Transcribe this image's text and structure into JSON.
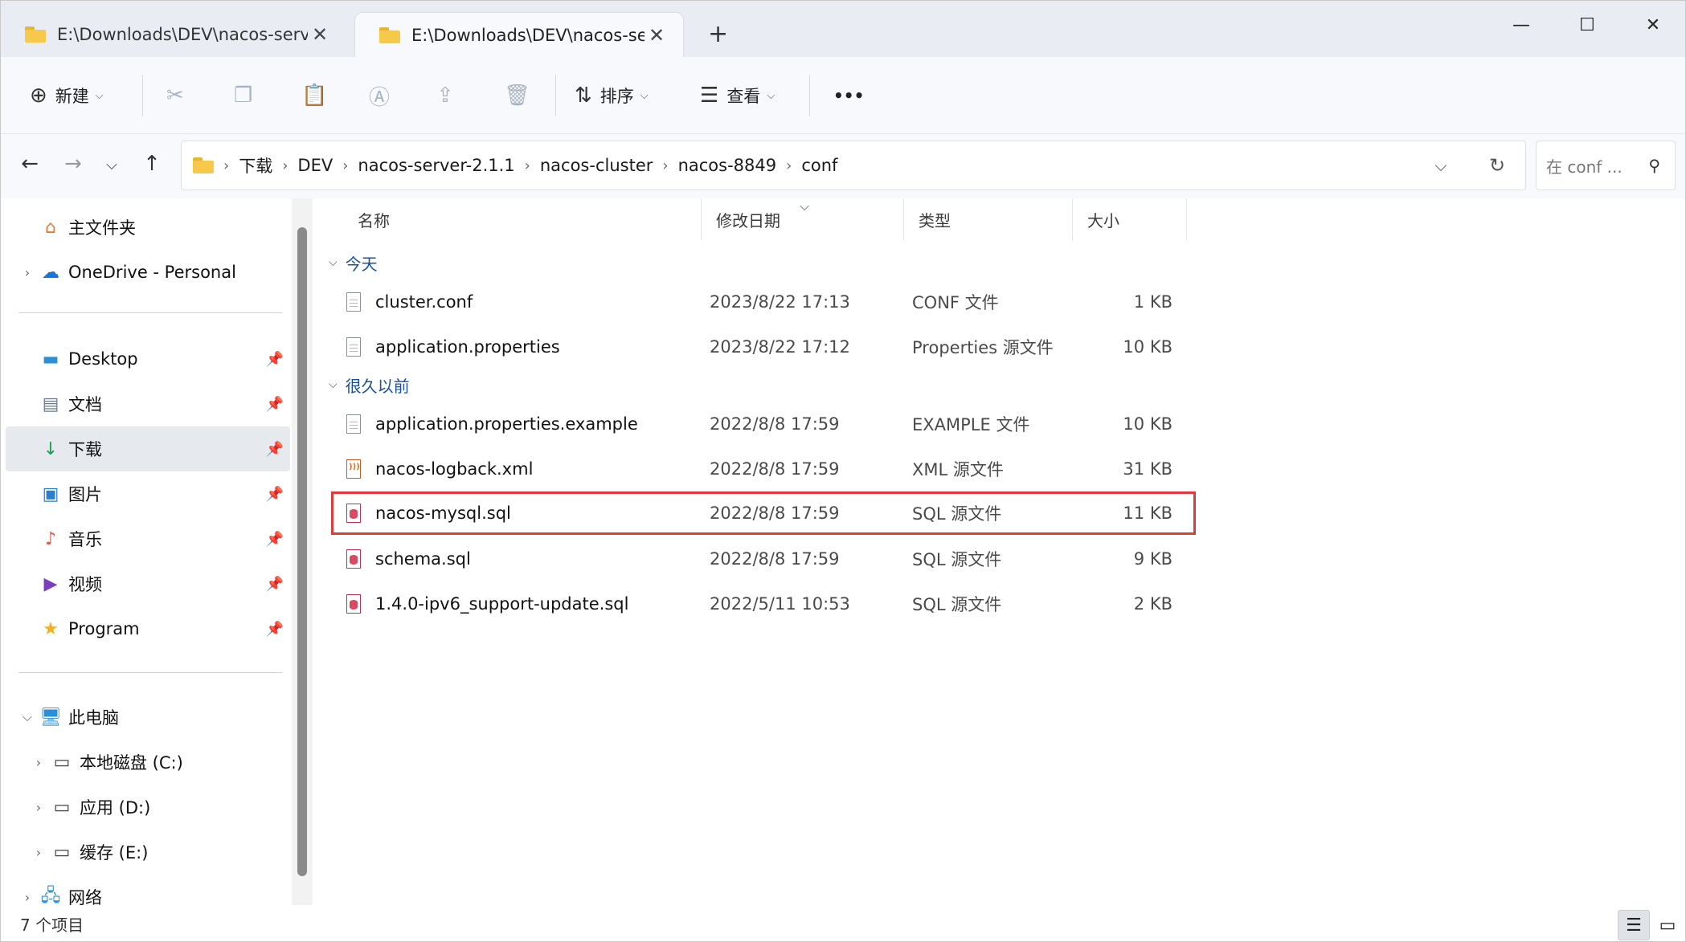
{
  "tabs": [
    {
      "title": "E:\\Downloads\\DEV\\nacos-serv",
      "active": false
    },
    {
      "title": "E:\\Downloads\\DEV\\nacos-serv",
      "active": true
    }
  ],
  "new_tab_label": "+",
  "window_controls": {
    "minimize": "—",
    "maximize": "☐",
    "close": "✕"
  },
  "toolbar": {
    "new_label": "新建",
    "sort_label": "排序",
    "view_label": "查看",
    "more_label": "•••"
  },
  "breadcrumb": [
    "下载",
    "DEV",
    "nacos-server-2.1.1",
    "nacos-cluster",
    "nacos-8849",
    "conf"
  ],
  "search": {
    "placeholder": "在 conf ..."
  },
  "sidebar": {
    "home": "主文件夹",
    "onedrive": "OneDrive - Personal",
    "quick_access": [
      {
        "label": "Desktop",
        "icon": "desktop-icon"
      },
      {
        "label": "文档",
        "icon": "documents-icon"
      },
      {
        "label": "下载",
        "icon": "download-icon"
      },
      {
        "label": "图片",
        "icon": "pictures-icon"
      },
      {
        "label": "音乐",
        "icon": "music-icon"
      },
      {
        "label": "视频",
        "icon": "videos-icon"
      },
      {
        "label": "Program",
        "icon": "star-icon"
      }
    ],
    "this_pc": "此电脑",
    "drives": [
      {
        "label": "本地磁盘 (C:)"
      },
      {
        "label": "应用 (D:)"
      },
      {
        "label": "缓存 (E:)"
      }
    ],
    "network": "网络"
  },
  "columns": {
    "name": "名称",
    "date": "修改日期",
    "type": "类型",
    "size": "大小"
  },
  "groups": {
    "today": "今天",
    "long_ago": "很久以前"
  },
  "files": [
    {
      "name": "cluster.conf",
      "date": "2023/8/22 17:13",
      "type": "CONF 文件",
      "size": "1 KB",
      "icon": "doc"
    },
    {
      "name": "application.properties",
      "date": "2023/8/22 17:12",
      "type": "Properties 源文件",
      "size": "10 KB",
      "icon": "doc"
    },
    {
      "name": "application.properties.example",
      "date": "2022/8/8 17:59",
      "type": "EXAMPLE 文件",
      "size": "10 KB",
      "icon": "doc"
    },
    {
      "name": "nacos-logback.xml",
      "date": "2022/8/8 17:59",
      "type": "XML 源文件",
      "size": "31 KB",
      "icon": "xml"
    },
    {
      "name": "nacos-mysql.sql",
      "date": "2022/8/8 17:59",
      "type": "SQL 源文件",
      "size": "11 KB",
      "icon": "sql"
    },
    {
      "name": "schema.sql",
      "date": "2022/8/8 17:59",
      "type": "SQL 源文件",
      "size": "9 KB",
      "icon": "sql"
    },
    {
      "name": "1.4.0-ipv6_support-update.sql",
      "date": "2022/5/11 10:53",
      "type": "SQL 源文件",
      "size": "2 KB",
      "icon": "sql"
    }
  ],
  "status": {
    "item_count": "7 个项目"
  },
  "colors": {
    "highlight_outline": "#e03a3a",
    "group_header": "#1a4fa0",
    "folder": "#f6c94a"
  }
}
